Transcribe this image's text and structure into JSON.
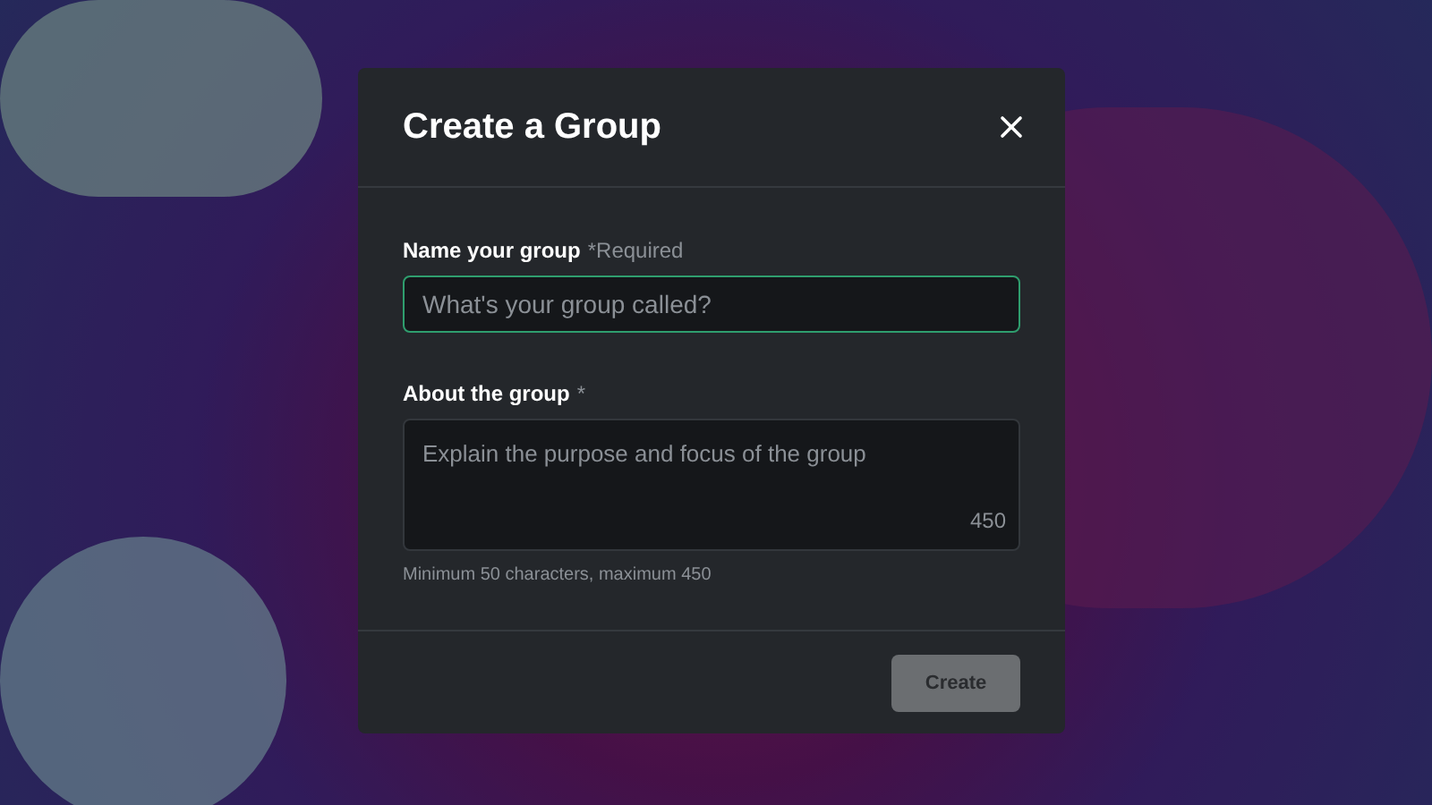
{
  "dialog": {
    "title": "Create a Group",
    "name_field": {
      "label": "Name your group",
      "required_note": "*Required",
      "placeholder": "What's your group called?",
      "focused": true
    },
    "about_field": {
      "label": "About the group",
      "required_note": "*",
      "placeholder": "Explain the purpose and focus of the group",
      "counter": "450",
      "helper": "Minimum 50 characters, maximum 450",
      "focused": false
    },
    "create_button": {
      "label": "Create",
      "disabled": true
    }
  }
}
